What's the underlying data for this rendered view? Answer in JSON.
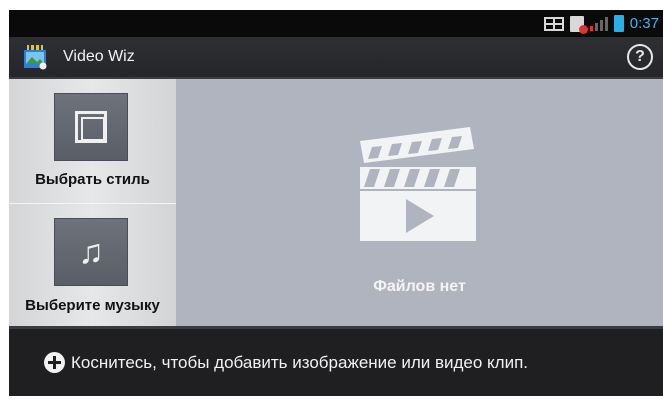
{
  "status_bar": {
    "time": "0:37",
    "icons": [
      "dual-sim-icon",
      "sim-alert-icon",
      "signal-icon",
      "battery-icon"
    ]
  },
  "action_bar": {
    "app_icon": "video-wiz-app-icon",
    "title": "Video Wiz",
    "help_label": "?"
  },
  "left_panel": {
    "style_button": {
      "icon": "frame-icon",
      "label": "Выбрать стиль"
    },
    "music_button": {
      "icon": "music-note-icon",
      "label": "Выберите музыку"
    }
  },
  "main": {
    "placeholder_icon": "clapperboard-play-icon",
    "empty_text": "Файлов нет"
  },
  "bottom_bar": {
    "add_icon": "plus-circle-icon",
    "hint": "Коснитесь, чтобы добавить изображение или видео клип."
  },
  "colors": {
    "status_time": "#3fb5e6",
    "main_bg": "#b0b4bf",
    "bar_bg": "#1f1f21"
  }
}
